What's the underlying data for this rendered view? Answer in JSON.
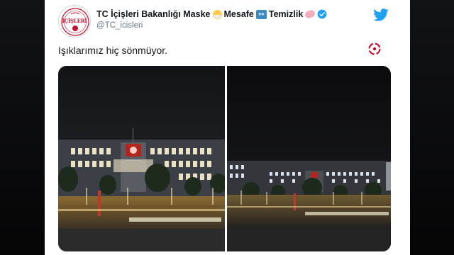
{
  "tweet": {
    "display_name": "TC İçişleri Bakanlığı Maske",
    "name_word_2": "Mesafe",
    "name_word_3": "Temizlik",
    "handle": "@TC_icisleri",
    "avatar_text": "İÇİŞLERİ",
    "text": "Işıklarımız hiç sönmüyor.",
    "icons": {
      "mask": "face-with-medical-mask-emoji",
      "arrows": "left-right-arrow-emoji",
      "soap": "soap-emoji",
      "verified": "verified-badge-icon",
      "brand": "twitter-bird-icon",
      "mark": "refresh-logo-icon"
    }
  },
  "colors": {
    "text_primary": "#14171a",
    "text_secondary": "#657786",
    "verified": "#1da1f2",
    "twitter_blue": "#1da1f2",
    "emblem_red": "#c8102e"
  }
}
